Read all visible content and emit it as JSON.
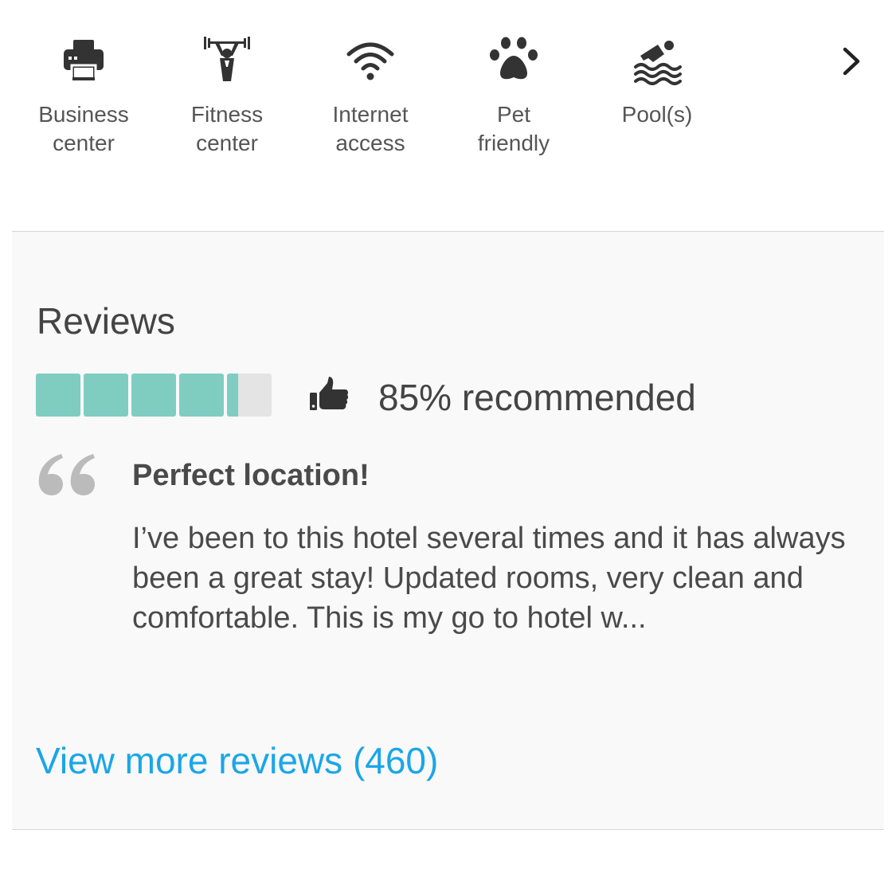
{
  "amenities": {
    "items": [
      {
        "label": "Business\ncenter",
        "icon": "printer-icon"
      },
      {
        "label": "Fitness\ncenter",
        "icon": "weightlifting-icon"
      },
      {
        "label": "Internet\naccess",
        "icon": "wifi-icon"
      },
      {
        "label": "Pet\nfriendly",
        "icon": "paw-icon"
      },
      {
        "label": "Pool(s)",
        "icon": "swimmer-icon"
      }
    ],
    "next_icon": "chevron-right-icon"
  },
  "reviews": {
    "title": "Reviews",
    "rating_fraction": 0.85,
    "rating_segments": 5,
    "recommended_text": "85% recommended",
    "thumbs_icon": "thumbs-up-icon",
    "quote_icon": "quote-icon",
    "featured": {
      "title": "Perfect location!",
      "body": "I’ve been to this hotel several times and it has always been a great stay! Updated rooms, very clean and comfortable. This is my go to hotel w..."
    },
    "view_more": "View more reviews (460)"
  },
  "colors": {
    "accent_teal": "#7fcdc1",
    "empty_bar": "#e4e4e4",
    "link_blue": "#1aa6e8",
    "panel_bg": "#f9f9f9",
    "icon_dark": "#333333",
    "quote_gray": "#bbbbbb"
  }
}
